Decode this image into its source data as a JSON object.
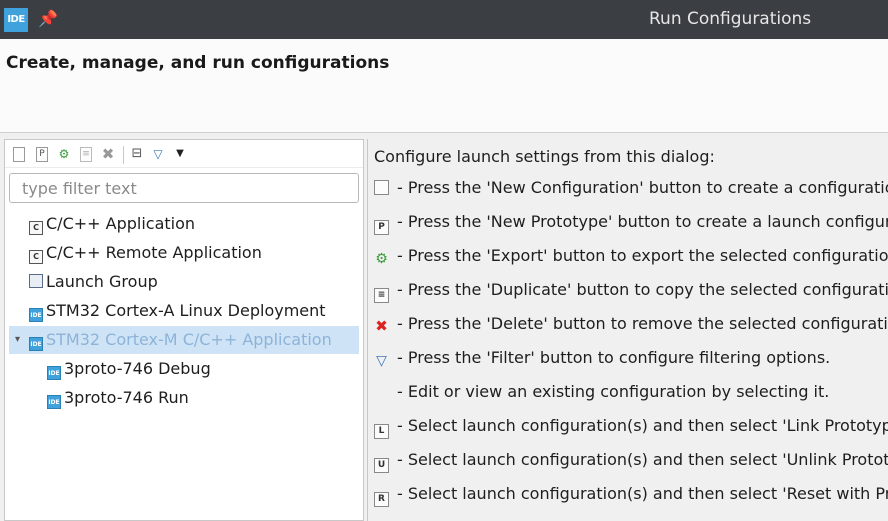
{
  "window": {
    "title": "Run Configurations",
    "app_icon": "IDE",
    "pin_icon": "pin-icon"
  },
  "banner": {
    "heading": "Create, manage, and run configurations"
  },
  "toolbar": {
    "items": [
      {
        "name": "new-configuration-icon"
      },
      {
        "name": "new-prototype-icon"
      },
      {
        "name": "export-icon"
      },
      {
        "name": "duplicate-icon"
      },
      {
        "name": "delete-icon"
      },
      {
        "name": "collapse-all-icon"
      },
      {
        "name": "filter-icon"
      },
      {
        "name": "view-menu-chevron-icon"
      }
    ]
  },
  "filter": {
    "placeholder": "type filter text",
    "value": ""
  },
  "tree": {
    "items": [
      {
        "label": "C/C++ Application",
        "icon": "c-app-icon",
        "glyph": "C"
      },
      {
        "label": "C/C++ Remote Application",
        "icon": "c-remote-app-icon",
        "glyph": "C"
      },
      {
        "label": "Launch Group",
        "icon": "launch-group-icon",
        "glyph": ""
      },
      {
        "label": "STM32 Cortex-A Linux Deployment",
        "icon": "ide-icon",
        "glyph": "IDE"
      },
      {
        "label": "STM32 Cortex-M C/C++ Application",
        "icon": "ide-icon",
        "glyph": "IDE",
        "selected": true,
        "expanded": true
      },
      {
        "label": "3proto-746 Debug",
        "icon": "ide-icon",
        "glyph": "IDE"
      },
      {
        "label": "3proto-746 Run",
        "icon": "ide-icon",
        "glyph": "IDE"
      }
    ]
  },
  "help": {
    "intro": "Configure launch settings from this dialog:",
    "lines": [
      {
        "text": "- Press the 'New Configuration' button to create a configuration o",
        "icon": "new-configuration-icon"
      },
      {
        "text": "- Press the 'New Prototype' button to create a launch configuratio",
        "icon": "new-prototype-icon"
      },
      {
        "text": "- Press the 'Export' button to export the selected configurations.",
        "icon": "export-icon"
      },
      {
        "text": "- Press the 'Duplicate' button to copy the selected configuration.",
        "icon": "duplicate-icon"
      },
      {
        "text": "- Press the 'Delete' button to remove the selected configuration.",
        "icon": "delete-icon"
      },
      {
        "text": "- Press the 'Filter' button to configure filtering options.",
        "icon": "filter-icon"
      },
      {
        "text": "- Edit or view an existing configuration by selecting it.",
        "icon": ""
      },
      {
        "text": "- Select launch configuration(s) and then select 'Link Prototype' m",
        "icon": "link-prototype-icon",
        "glyph": "L"
      },
      {
        "text": "- Select launch configuration(s) and then select 'Unlink Prototype",
        "icon": "unlink-prototype-icon",
        "glyph": "U"
      },
      {
        "text": "- Select launch configuration(s) and then select 'Reset with Protot",
        "icon": "reset-prototype-icon",
        "glyph": "R"
      }
    ]
  }
}
